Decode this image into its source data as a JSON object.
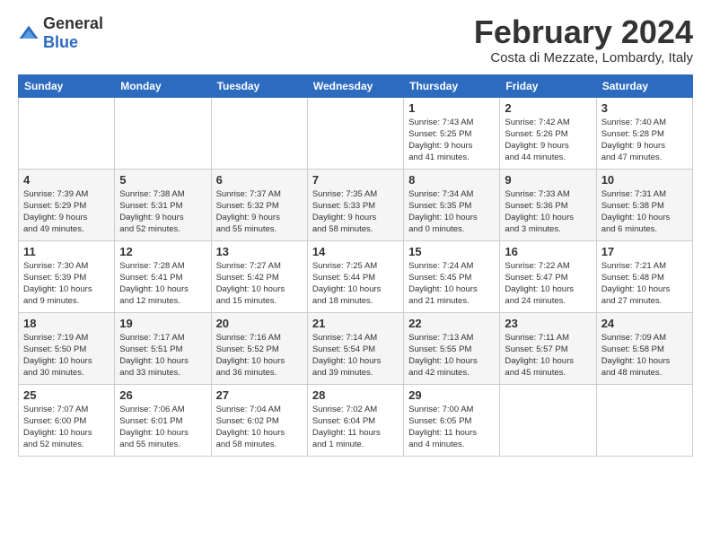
{
  "logo": {
    "general": "General",
    "blue": "Blue"
  },
  "header": {
    "month": "February 2024",
    "location": "Costa di Mezzate, Lombardy, Italy"
  },
  "days_of_week": [
    "Sunday",
    "Monday",
    "Tuesday",
    "Wednesday",
    "Thursday",
    "Friday",
    "Saturday"
  ],
  "weeks": [
    [
      {
        "day": "",
        "info": ""
      },
      {
        "day": "",
        "info": ""
      },
      {
        "day": "",
        "info": ""
      },
      {
        "day": "",
        "info": ""
      },
      {
        "day": "1",
        "info": "Sunrise: 7:43 AM\nSunset: 5:25 PM\nDaylight: 9 hours\nand 41 minutes."
      },
      {
        "day": "2",
        "info": "Sunrise: 7:42 AM\nSunset: 5:26 PM\nDaylight: 9 hours\nand 44 minutes."
      },
      {
        "day": "3",
        "info": "Sunrise: 7:40 AM\nSunset: 5:28 PM\nDaylight: 9 hours\nand 47 minutes."
      }
    ],
    [
      {
        "day": "4",
        "info": "Sunrise: 7:39 AM\nSunset: 5:29 PM\nDaylight: 9 hours\nand 49 minutes."
      },
      {
        "day": "5",
        "info": "Sunrise: 7:38 AM\nSunset: 5:31 PM\nDaylight: 9 hours\nand 52 minutes."
      },
      {
        "day": "6",
        "info": "Sunrise: 7:37 AM\nSunset: 5:32 PM\nDaylight: 9 hours\nand 55 minutes."
      },
      {
        "day": "7",
        "info": "Sunrise: 7:35 AM\nSunset: 5:33 PM\nDaylight: 9 hours\nand 58 minutes."
      },
      {
        "day": "8",
        "info": "Sunrise: 7:34 AM\nSunset: 5:35 PM\nDaylight: 10 hours\nand 0 minutes."
      },
      {
        "day": "9",
        "info": "Sunrise: 7:33 AM\nSunset: 5:36 PM\nDaylight: 10 hours\nand 3 minutes."
      },
      {
        "day": "10",
        "info": "Sunrise: 7:31 AM\nSunset: 5:38 PM\nDaylight: 10 hours\nand 6 minutes."
      }
    ],
    [
      {
        "day": "11",
        "info": "Sunrise: 7:30 AM\nSunset: 5:39 PM\nDaylight: 10 hours\nand 9 minutes."
      },
      {
        "day": "12",
        "info": "Sunrise: 7:28 AM\nSunset: 5:41 PM\nDaylight: 10 hours\nand 12 minutes."
      },
      {
        "day": "13",
        "info": "Sunrise: 7:27 AM\nSunset: 5:42 PM\nDaylight: 10 hours\nand 15 minutes."
      },
      {
        "day": "14",
        "info": "Sunrise: 7:25 AM\nSunset: 5:44 PM\nDaylight: 10 hours\nand 18 minutes."
      },
      {
        "day": "15",
        "info": "Sunrise: 7:24 AM\nSunset: 5:45 PM\nDaylight: 10 hours\nand 21 minutes."
      },
      {
        "day": "16",
        "info": "Sunrise: 7:22 AM\nSunset: 5:47 PM\nDaylight: 10 hours\nand 24 minutes."
      },
      {
        "day": "17",
        "info": "Sunrise: 7:21 AM\nSunset: 5:48 PM\nDaylight: 10 hours\nand 27 minutes."
      }
    ],
    [
      {
        "day": "18",
        "info": "Sunrise: 7:19 AM\nSunset: 5:50 PM\nDaylight: 10 hours\nand 30 minutes."
      },
      {
        "day": "19",
        "info": "Sunrise: 7:17 AM\nSunset: 5:51 PM\nDaylight: 10 hours\nand 33 minutes."
      },
      {
        "day": "20",
        "info": "Sunrise: 7:16 AM\nSunset: 5:52 PM\nDaylight: 10 hours\nand 36 minutes."
      },
      {
        "day": "21",
        "info": "Sunrise: 7:14 AM\nSunset: 5:54 PM\nDaylight: 10 hours\nand 39 minutes."
      },
      {
        "day": "22",
        "info": "Sunrise: 7:13 AM\nSunset: 5:55 PM\nDaylight: 10 hours\nand 42 minutes."
      },
      {
        "day": "23",
        "info": "Sunrise: 7:11 AM\nSunset: 5:57 PM\nDaylight: 10 hours\nand 45 minutes."
      },
      {
        "day": "24",
        "info": "Sunrise: 7:09 AM\nSunset: 5:58 PM\nDaylight: 10 hours\nand 48 minutes."
      }
    ],
    [
      {
        "day": "25",
        "info": "Sunrise: 7:07 AM\nSunset: 6:00 PM\nDaylight: 10 hours\nand 52 minutes."
      },
      {
        "day": "26",
        "info": "Sunrise: 7:06 AM\nSunset: 6:01 PM\nDaylight: 10 hours\nand 55 minutes."
      },
      {
        "day": "27",
        "info": "Sunrise: 7:04 AM\nSunset: 6:02 PM\nDaylight: 10 hours\nand 58 minutes."
      },
      {
        "day": "28",
        "info": "Sunrise: 7:02 AM\nSunset: 6:04 PM\nDaylight: 11 hours\nand 1 minute."
      },
      {
        "day": "29",
        "info": "Sunrise: 7:00 AM\nSunset: 6:05 PM\nDaylight: 11 hours\nand 4 minutes."
      },
      {
        "day": "",
        "info": ""
      },
      {
        "day": "",
        "info": ""
      }
    ]
  ]
}
